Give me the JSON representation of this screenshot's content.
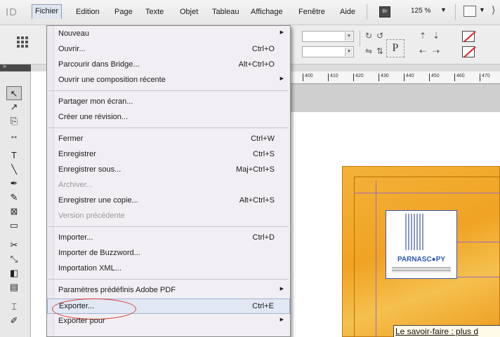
{
  "menubar": {
    "logo": "ID",
    "items": [
      "Fichier",
      "Edition",
      "Page",
      "Texte",
      "Objet",
      "Tableau",
      "Affichage",
      "Fenêtre",
      "Aide"
    ],
    "bridge": "Br",
    "zoom": "125 %",
    "zoom_arrow": "▼",
    "view_arrow": "▼",
    "more": "⟩"
  },
  "controlbar": {
    "p_label": "P"
  },
  "toolbar": {
    "header": "»",
    "tools": [
      {
        "name": "selection-tool",
        "glyph": "↖"
      },
      {
        "name": "direct-selection-tool",
        "glyph": "↗"
      },
      {
        "name": "page-tool",
        "glyph": "⎘"
      },
      {
        "name": "gap-tool",
        "glyph": "↔"
      },
      {
        "name": "type-tool",
        "glyph": "T"
      },
      {
        "name": "line-tool",
        "glyph": "╲"
      },
      {
        "name": "pen-tool",
        "glyph": "✒"
      },
      {
        "name": "pencil-tool",
        "glyph": "✎"
      },
      {
        "name": "rectangle-frame-tool",
        "glyph": "⊠"
      },
      {
        "name": "rectangle-tool",
        "glyph": "▭"
      },
      {
        "name": "scissors-tool",
        "glyph": "✂"
      },
      {
        "name": "free-transform-tool",
        "glyph": "⤡"
      },
      {
        "name": "gradient-tool",
        "glyph": "◧"
      },
      {
        "name": "note-tool",
        "glyph": "▤"
      },
      {
        "name": "eyedropper-tool",
        "glyph": "⌶"
      },
      {
        "name": "hand-tool",
        "glyph": "✐"
      }
    ]
  },
  "ruler": {
    "ticks": [
      "400",
      "410",
      "420",
      "430",
      "440",
      "450",
      "460",
      "470"
    ]
  },
  "document": {
    "logo_text": "PARNASC●PY",
    "caption": "Le savoir-faire : plus d"
  },
  "file_menu": {
    "items": [
      {
        "label": "Nouveau",
        "shortcut": "",
        "submenu": true,
        "disabled": false
      },
      {
        "label": "Ouvrir...",
        "shortcut": "Ctrl+O",
        "submenu": false,
        "disabled": false
      },
      {
        "label": "Parcourir dans Bridge...",
        "shortcut": "Alt+Ctrl+O",
        "submenu": false,
        "disabled": false
      },
      {
        "label": "Ouvrir une composition récente",
        "shortcut": "",
        "submenu": true,
        "disabled": false
      },
      {
        "label": "Partager mon écran...",
        "shortcut": "",
        "submenu": false,
        "disabled": false
      },
      {
        "label": "Créer une révision...",
        "shortcut": "",
        "submenu": false,
        "disabled": false
      },
      {
        "label": "Fermer",
        "shortcut": "Ctrl+W",
        "submenu": false,
        "disabled": false
      },
      {
        "label": "Enregistrer",
        "shortcut": "Ctrl+S",
        "submenu": false,
        "disabled": false
      },
      {
        "label": "Enregistrer sous...",
        "shortcut": "Maj+Ctrl+S",
        "submenu": false,
        "disabled": false
      },
      {
        "label": "Archiver...",
        "shortcut": "",
        "submenu": false,
        "disabled": true
      },
      {
        "label": "Enregistrer une copie...",
        "shortcut": "Alt+Ctrl+S",
        "submenu": false,
        "disabled": false
      },
      {
        "label": "Version précédente",
        "shortcut": "",
        "submenu": false,
        "disabled": true
      },
      {
        "label": "Importer...",
        "shortcut": "Ctrl+D",
        "submenu": false,
        "disabled": false
      },
      {
        "label": "Importer de Buzzword...",
        "shortcut": "",
        "submenu": false,
        "disabled": false
      },
      {
        "label": "Importation XML...",
        "shortcut": "",
        "submenu": false,
        "disabled": false
      },
      {
        "label": "Paramètres prédéfinis Adobe PDF",
        "shortcut": "",
        "submenu": true,
        "disabled": false
      },
      {
        "label": "Exporter...",
        "shortcut": "Ctrl+E",
        "submenu": false,
        "disabled": false,
        "highlighted": true
      },
      {
        "label": "Exporter pour",
        "shortcut": "",
        "submenu": true,
        "disabled": false
      }
    ]
  }
}
